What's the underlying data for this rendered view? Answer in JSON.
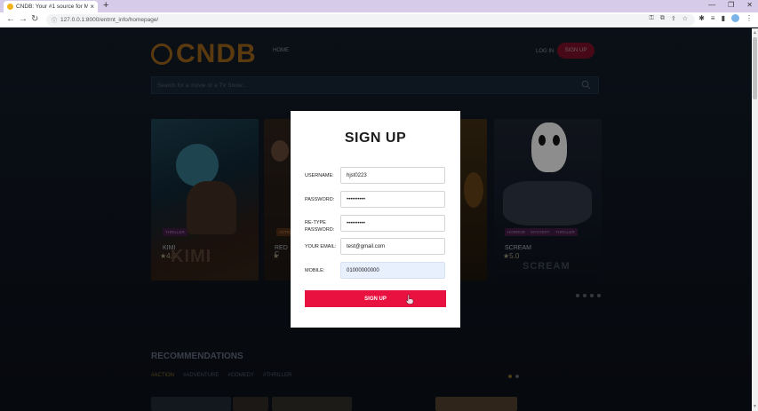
{
  "browser": {
    "tab_title": "CNDB: Your #1 source for Mov",
    "tab_close": "×",
    "new_tab": "+",
    "window_controls": [
      "—",
      "❐",
      "✕"
    ],
    "url": "127.0.0.1:8000/entrnt_info/homepage/"
  },
  "site": {
    "logo": "CNDB",
    "nav_home": "HOME",
    "nav_login": "LOG IN",
    "nav_signup": "SIGN UP",
    "search_placeholder": "Search for a movie or a TV Show..."
  },
  "carousel": {
    "cards": [
      {
        "title": "KIMI",
        "genre": "THRILLER",
        "rating": "★4.0",
        "poster_text": "KIMI"
      },
      {
        "title": "RED C",
        "genre": "ACTIO",
        "rating": "★"
      },
      {
        "title": "SCREAM",
        "genres": [
          "HORROR",
          "MYSTERY",
          "THRILLER"
        ],
        "rating": "★5.0",
        "poster_text": "SCREAM"
      }
    ]
  },
  "recommendations": {
    "title": "RECOMMENDATIONS",
    "tabs": [
      "#ACTION",
      "#ADVENTURE",
      "#COMEDY",
      "#THRILLER"
    ]
  },
  "modal": {
    "title": "SIGN UP",
    "fields": [
      {
        "label": "USERNAME:",
        "value": "hjst0223"
      },
      {
        "label": "PASSWORD:",
        "value": "••••••••••"
      },
      {
        "label": "RE-TYPE PASSWORD:",
        "value": "••••••••••"
      },
      {
        "label": "YOUR EMAIL:",
        "value": "test@gmail.com"
      },
      {
        "label": "MOBILE:",
        "value": "01000000000"
      }
    ],
    "submit_label": "SIGN UP"
  },
  "colors": {
    "accent": "#e8113f",
    "logo": "#8a5a16"
  }
}
